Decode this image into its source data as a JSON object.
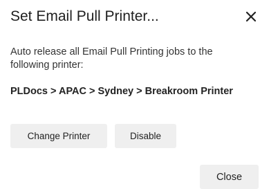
{
  "dialog": {
    "title": "Set Email Pull Printer...",
    "close_icon": "close-icon",
    "description": "Auto release all Email Pull Printing jobs to the following printer:",
    "printer_path": "PLDocs > APAC > Sydney > Breakroom Printer",
    "buttons": {
      "change_printer": "Change Printer",
      "disable": "Disable",
      "close": "Close"
    }
  }
}
